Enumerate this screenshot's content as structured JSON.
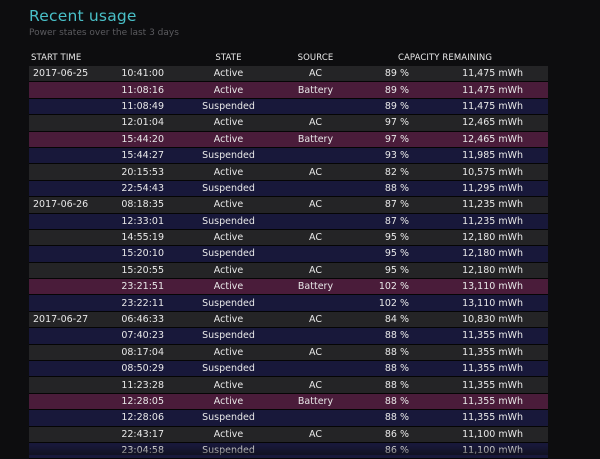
{
  "header": {
    "title": "Recent usage",
    "subtitle": "Power states over the last 3 days"
  },
  "table": {
    "columns": {
      "start_time": "START TIME",
      "state": "STATE",
      "source": "SOURCE",
      "capacity": "CAPACITY REMAINING"
    },
    "rows": [
      {
        "date": "2017-06-25",
        "time": "10:41:00",
        "state": "Active",
        "source": "AC",
        "percent": "89 %",
        "mwh": "11,475 mWh"
      },
      {
        "date": "",
        "time": "11:08:16",
        "state": "Active",
        "source": "Battery",
        "percent": "89 %",
        "mwh": "11,475 mWh"
      },
      {
        "date": "",
        "time": "11:08:49",
        "state": "Suspended",
        "source": "",
        "percent": "89 %",
        "mwh": "11,475 mWh"
      },
      {
        "date": "",
        "time": "12:01:04",
        "state": "Active",
        "source": "AC",
        "percent": "97 %",
        "mwh": "12,465 mWh"
      },
      {
        "date": "",
        "time": "15:44:20",
        "state": "Active",
        "source": "Battery",
        "percent": "97 %",
        "mwh": "12,465 mWh"
      },
      {
        "date": "",
        "time": "15:44:27",
        "state": "Suspended",
        "source": "",
        "percent": "93 %",
        "mwh": "11,985 mWh"
      },
      {
        "date": "",
        "time": "20:15:53",
        "state": "Active",
        "source": "AC",
        "percent": "82 %",
        "mwh": "10,575 mWh"
      },
      {
        "date": "",
        "time": "22:54:43",
        "state": "Suspended",
        "source": "",
        "percent": "88 %",
        "mwh": "11,295 mWh"
      },
      {
        "date": "2017-06-26",
        "time": "08:18:35",
        "state": "Active",
        "source": "AC",
        "percent": "87 %",
        "mwh": "11,235 mWh"
      },
      {
        "date": "",
        "time": "12:33:01",
        "state": "Suspended",
        "source": "",
        "percent": "87 %",
        "mwh": "11,235 mWh"
      },
      {
        "date": "",
        "time": "14:55:19",
        "state": "Active",
        "source": "AC",
        "percent": "95 %",
        "mwh": "12,180 mWh"
      },
      {
        "date": "",
        "time": "15:20:10",
        "state": "Suspended",
        "source": "",
        "percent": "95 %",
        "mwh": "12,180 mWh"
      },
      {
        "date": "",
        "time": "15:20:55",
        "state": "Active",
        "source": "AC",
        "percent": "95 %",
        "mwh": "12,180 mWh"
      },
      {
        "date": "",
        "time": "23:21:51",
        "state": "Active",
        "source": "Battery",
        "percent": "102 %",
        "mwh": "13,110 mWh"
      },
      {
        "date": "",
        "time": "23:22:11",
        "state": "Suspended",
        "source": "",
        "percent": "102 %",
        "mwh": "13,110 mWh"
      },
      {
        "date": "2017-06-27",
        "time": "06:46:33",
        "state": "Active",
        "source": "AC",
        "percent": "84 %",
        "mwh": "10,830 mWh"
      },
      {
        "date": "",
        "time": "07:40:23",
        "state": "Suspended",
        "source": "",
        "percent": "88 %",
        "mwh": "11,355 mWh"
      },
      {
        "date": "",
        "time": "08:17:04",
        "state": "Active",
        "source": "AC",
        "percent": "88 %",
        "mwh": "11,355 mWh"
      },
      {
        "date": "",
        "time": "08:50:29",
        "state": "Suspended",
        "source": "",
        "percent": "88 %",
        "mwh": "11,355 mWh"
      },
      {
        "date": "",
        "time": "11:23:28",
        "state": "Active",
        "source": "AC",
        "percent": "88 %",
        "mwh": "11,355 mWh"
      },
      {
        "date": "",
        "time": "12:28:05",
        "state": "Active",
        "source": "Battery",
        "percent": "88 %",
        "mwh": "11,355 mWh"
      },
      {
        "date": "",
        "time": "12:28:06",
        "state": "Suspended",
        "source": "",
        "percent": "88 %",
        "mwh": "11,355 mWh"
      },
      {
        "date": "",
        "time": "22:43:17",
        "state": "Active",
        "source": "AC",
        "percent": "86 %",
        "mwh": "11,100 mWh"
      },
      {
        "date": "",
        "time": "23:04:58",
        "state": "Suspended",
        "source": "",
        "percent": "86 %",
        "mwh": "11,100 mWh"
      }
    ]
  },
  "colors": {
    "title": "#49c0c8",
    "ac_row": "#242426",
    "suspended_row": "#18183a",
    "battery_row": "#4a1c3a"
  }
}
